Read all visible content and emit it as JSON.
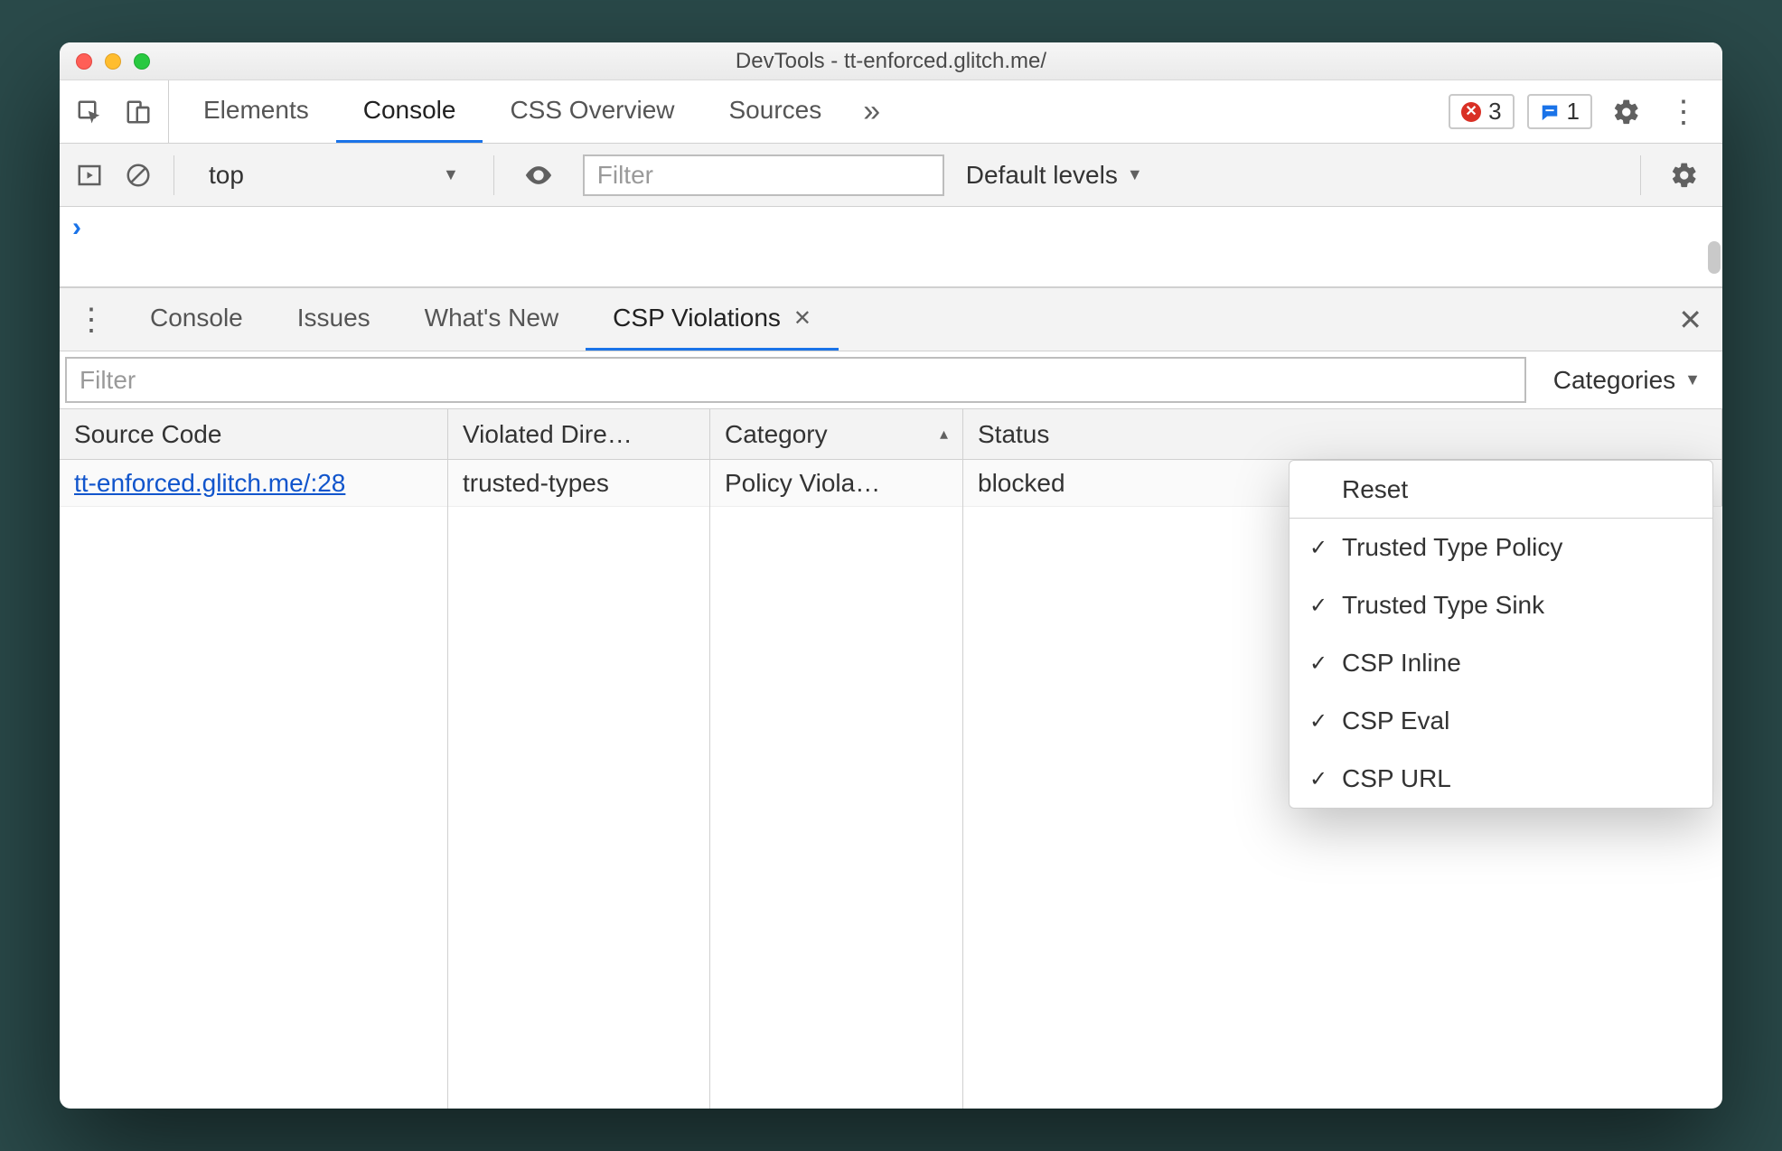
{
  "window": {
    "title": "DevTools - tt-enforced.glitch.me/"
  },
  "main_tabs": {
    "items": [
      "Elements",
      "Console",
      "CSS Overview",
      "Sources"
    ],
    "active_index": 1,
    "error_count": "3",
    "message_count": "1"
  },
  "console_toolbar": {
    "context": "top",
    "filter_placeholder": "Filter",
    "levels_label": "Default levels"
  },
  "drawer_tabs": {
    "items": [
      "Console",
      "Issues",
      "What's New",
      "CSP Violations"
    ],
    "active_index": 3
  },
  "csp": {
    "filter_placeholder": "Filter",
    "categories_label": "Categories",
    "columns": [
      "Source Code",
      "Violated Dire…",
      "Category",
      "Status"
    ],
    "sort_column_index": 2,
    "sort_direction": "asc",
    "rows": [
      {
        "source": "tt-enforced.glitch.me/:28",
        "directive": "trusted-types",
        "category": "Policy Viola…",
        "status": "blocked"
      }
    ]
  },
  "categories_menu": {
    "reset_label": "Reset",
    "items": [
      {
        "label": "Trusted Type Policy",
        "checked": true
      },
      {
        "label": "Trusted Type Sink",
        "checked": true
      },
      {
        "label": "CSP Inline",
        "checked": true
      },
      {
        "label": "CSP Eval",
        "checked": true
      },
      {
        "label": "CSP URL",
        "checked": true
      }
    ]
  }
}
